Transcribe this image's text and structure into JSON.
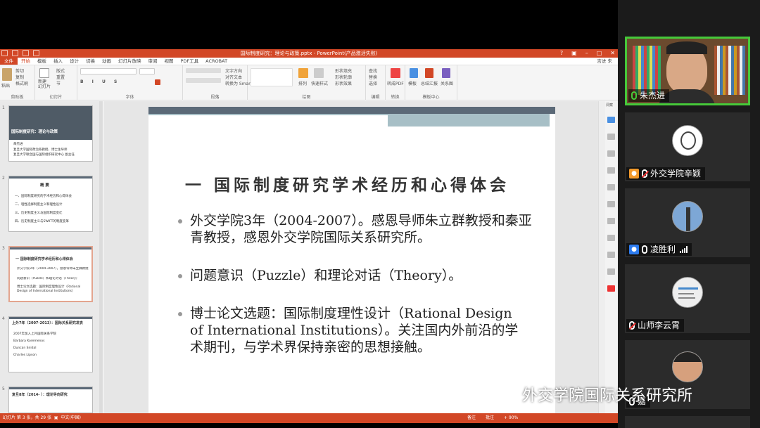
{
  "window": {
    "title": "国际制度研究：理论与政策.pptx - PowerPoint(产品激活失败)",
    "user": "吉进 朱"
  },
  "tabs": [
    "文件",
    "开始",
    "模板",
    "插入",
    "设计",
    "切换",
    "动画",
    "幻灯片放映",
    "审阅",
    "视图",
    "PDF工具",
    "ACROBAT"
  ],
  "ribbon": {
    "groups": [
      "剪贴板",
      "幻灯片",
      "字体",
      "段落",
      "绘图",
      "编辑",
      "转换",
      "模板中心"
    ],
    "paste": "粘贴",
    "cut": "剪切",
    "copy": "复制",
    "format_painter": "格式刷",
    "new_slide": "新建\n幻灯片",
    "layout": "版式",
    "reset": "重置",
    "section": "节",
    "text_direction": "文字方向",
    "align_text": "对齐文本",
    "smartart": "转换为 SmartArt",
    "arrange": "排列",
    "quick_styles": "快速样式",
    "shape_fill": "形状填充",
    "shape_outline": "形状轮廓",
    "shape_effects": "形状效果",
    "find": "查找",
    "replace": "替换",
    "select": "选择",
    "to_pdf": "转成PDF",
    "template": "模板",
    "summary": "总结汇报",
    "relation": "关系图"
  },
  "thumbnails": [
    {
      "num": "1",
      "title": "国际制度研究：理论与政策",
      "lines": [
        "朱杰进",
        "复旦大学国际政治系教授、博士生导师",
        "复旦大学联合国与国际组织研究中心 副主任"
      ]
    },
    {
      "num": "2",
      "title": "概 要",
      "lines": [
        "一、国际制度研究的学术经历和心得体会",
        "二、理性选择制度主义和理性设计",
        "三、历史制度主义与国际制度变迁",
        "四、历史制度主义与SWIFT的制度变革"
      ]
    },
    {
      "num": "3",
      "title": "一 国际制度研究学术经历和心得体会",
      "lines": [
        "外交学院3年（2004-2007）。感恩导师朱立群教授",
        "问题意识（Puzzle）和理论对话（Theory）",
        "博士论文选题：国际制度理性设计（Rational Design of International Institutions）"
      ]
    },
    {
      "num": "4",
      "title": "上外7年（2007-2013）：国际关系研究发表",
      "lines": [
        "2007年加入上外国际关系学院",
        "Barbara Koremenos",
        "Duncan Snidal",
        "Charles Lipson"
      ]
    },
    {
      "num": "5",
      "title": "复旦8年（2014- ）：理论导向研究",
      "lines": []
    }
  ],
  "slide": {
    "title": "一 国际制度研究学术经历和心得体会",
    "bullets": [
      "外交学院3年（2004-2007）。感恩导师朱立群教授和秦亚青教授，感恩外交学院国际关系研究所。",
      "问题意识（Puzzle）和理论对话（Theory）。",
      "博士论文选题：国际制度理性设计（Rational Design of International Institutions）。关注国内外前沿的学术期刊，与学术界保持亲密的思想接触。"
    ]
  },
  "right_panel": {
    "label": "洞察"
  },
  "status": {
    "slide_info": "幻灯片 第 3 张，共 29 张",
    "language": "中文(中国)",
    "notes": "备注",
    "comments": "批注",
    "zoom": "+ 90%"
  },
  "participants": [
    {
      "name": "朱杰进",
      "mic": "on",
      "active": true
    },
    {
      "name": "外交学院辛颖",
      "mic": "off",
      "active": false
    },
    {
      "name": "凌胜利",
      "mic": "on",
      "active": false
    },
    {
      "name": "山师李云霄",
      "mic": "off",
      "active": false
    },
    {
      "name": "嘉",
      "mic": "on",
      "active": false
    }
  ],
  "watermark": "外交学院国际关系研究所",
  "colors": {
    "accent": "#d24726",
    "active_speaker": "#46c93a"
  }
}
